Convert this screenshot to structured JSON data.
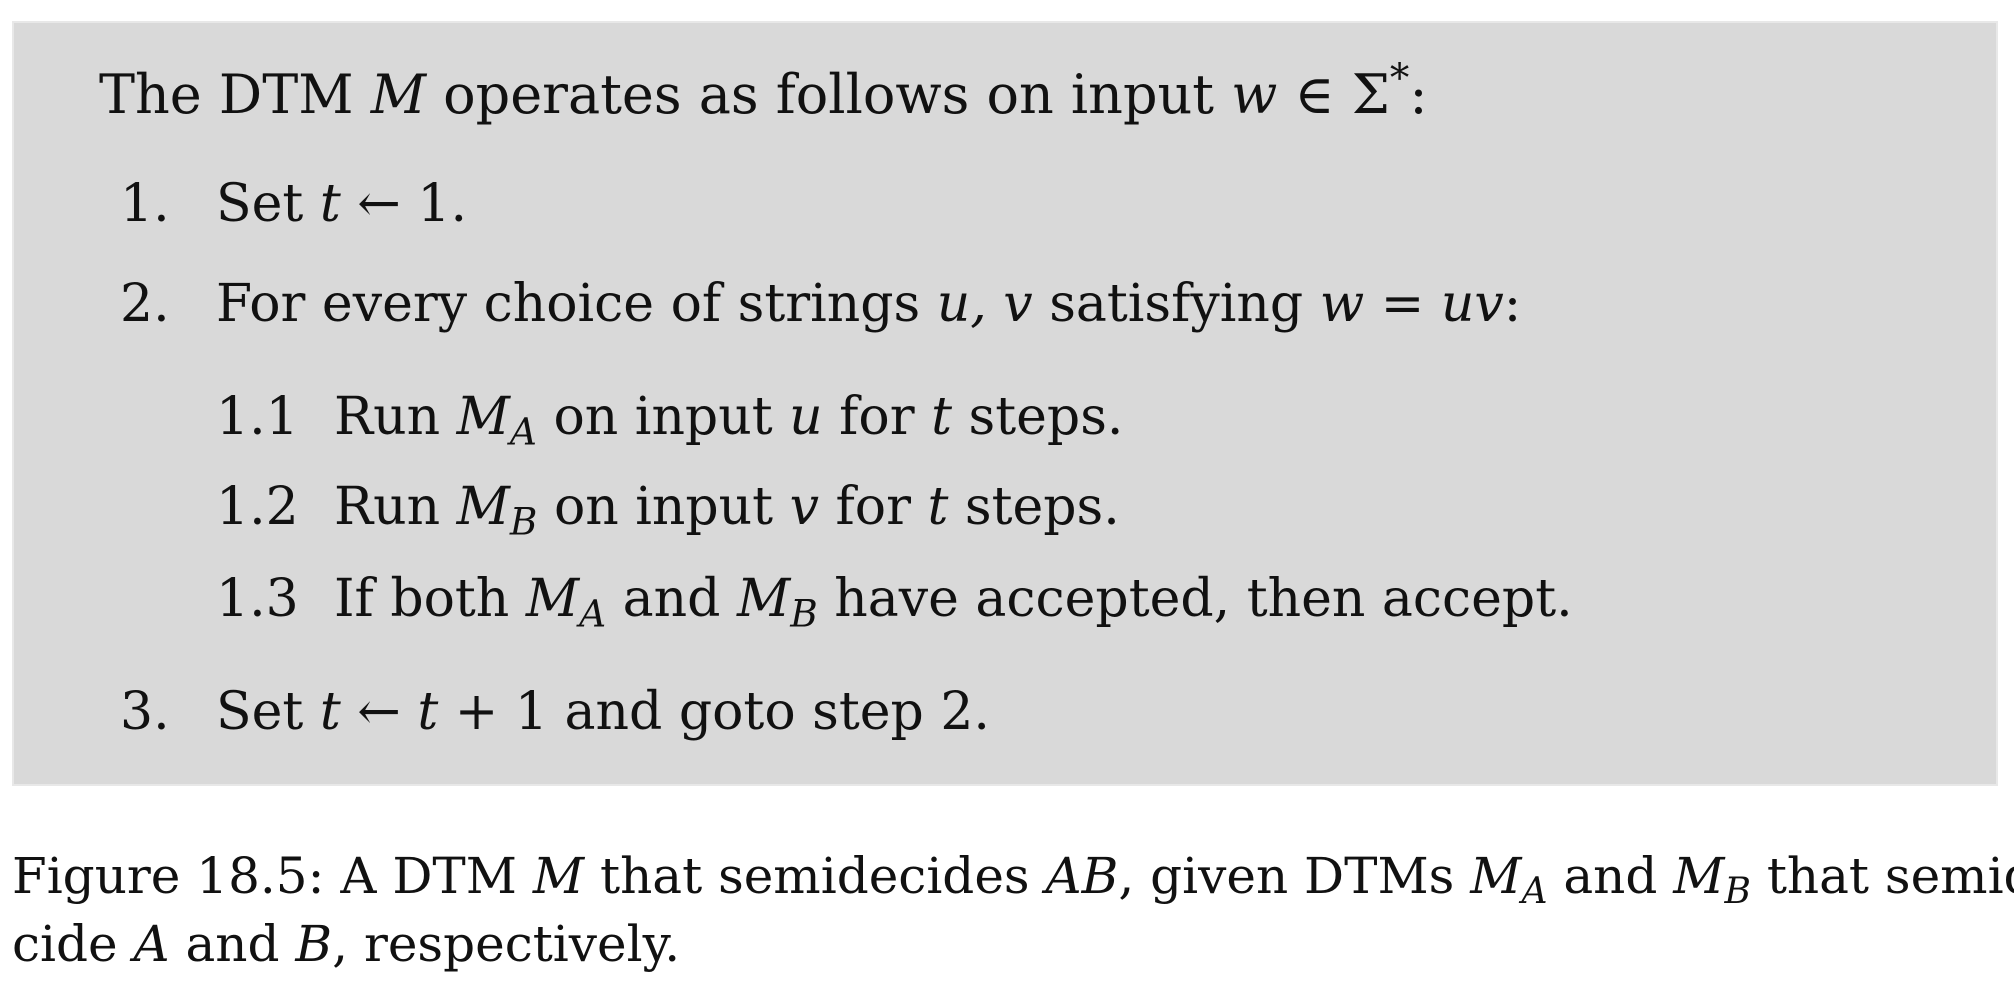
{
  "algorithm": {
    "intro": {
      "p1": "The DTM ",
      "m": "M",
      "p2": " operates as follows on input ",
      "w": "w",
      "p3": " ∈ Σ",
      "star": "*",
      "p4": ":"
    },
    "step1": {
      "num": "1.",
      "p1": "Set ",
      "t": "t",
      "p2": " ← 1."
    },
    "step2": {
      "num": "2.",
      "p1": "For every choice of strings ",
      "uv": "u, v",
      "p2": " satisfying ",
      "w": "w",
      "p3": " = ",
      "uv2": "uv",
      "p4": ":"
    },
    "sub1": {
      "num": "1.1",
      "p1": "Run ",
      "m": "M",
      "a": "A",
      "p2": " on input ",
      "u": "u",
      "p3": " for ",
      "t": "t",
      "p4": " steps."
    },
    "sub2": {
      "num": "1.2",
      "p1": "Run ",
      "m": "M",
      "b": "B",
      "p2": " on input ",
      "v": "v",
      "p3": " for ",
      "t": "t",
      "p4": " steps."
    },
    "sub3": {
      "num": "1.3",
      "p1": "If both ",
      "m1": "M",
      "a": "A",
      "p2": " and ",
      "m2": "M",
      "b": "B",
      "p3": " have accepted, then accept."
    },
    "step3": {
      "num": "3.",
      "p1": "Set ",
      "t1": "t",
      "p2": " ← ",
      "t2": "t",
      "p3": " + 1 and goto step 2."
    }
  },
  "caption": {
    "p1": "Figure 18.5: A DTM ",
    "m": "M",
    "p2": " that semidecides ",
    "ab": "AB",
    "p3": ", given DTMs ",
    "m1": "M",
    "a": "A",
    "p4": " and ",
    "m2": "M",
    "b": "B",
    "p5": " that semide-",
    "p6": "cide ",
    "a2": "A",
    "p7": " and ",
    "b2": "B",
    "p8": ", respectively."
  }
}
